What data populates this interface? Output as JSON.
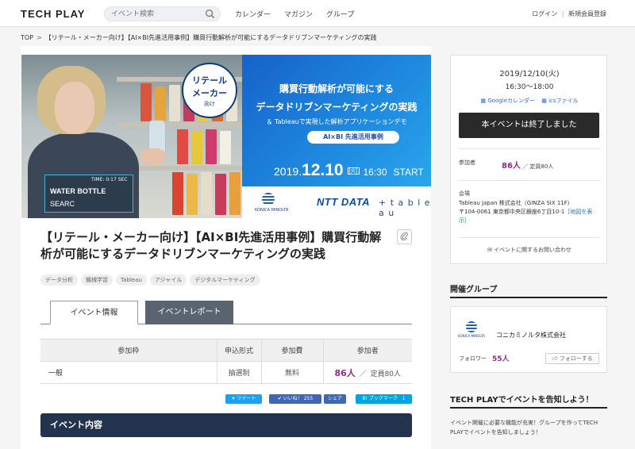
{
  "header": {
    "logo": "TECH PLAY",
    "search_placeholder": "イベント検索",
    "nav": [
      "カレンダー",
      "マガジン",
      "グループ"
    ],
    "login": "ログイン",
    "divider": "|",
    "register": "新規会員登録"
  },
  "breadcrumb": {
    "top": "TOP",
    "sep": ">",
    "current": "【リテール・メーカー向け】【AI×BI先進活用事例】購買行動解析が可能にするデータドリブンマーケティングの実践"
  },
  "hero": {
    "circle_line1": "リテール",
    "circle_line2": "メーカー",
    "circle_line3": "向け",
    "overlay_time": "TIME: 0:17 SEC",
    "overlay_label": "WATER BOTTLE",
    "overlay_search": "SEARC",
    "heading_line1": "購買行動解析が可能にする",
    "heading_line2": "データドリブンマーケティングの実践",
    "subheading": "＆ Tableauで実現した解析アプリケーションデモ",
    "pill": "AI×BI 先進活用事例",
    "date_year": "2019.",
    "date_md": "12.10",
    "date_dow": "[火]",
    "date_time": "16:30",
    "date_start": "START",
    "logo1_name": "KONICA MINOLTA",
    "logo2": "NTT DATA",
    "logo3": "+ t a b l e a u"
  },
  "event": {
    "title": "【リテール・メーカー向け】【AI×BI先進活用事例】購買行動解析が可能にするデータドリブンマーケティングの実践",
    "tags": [
      "データ分析",
      "機械学習",
      "Tableau",
      "アジャイル",
      "デジタルマーケティング"
    ]
  },
  "tabs": {
    "info": "イベント情報",
    "report": "イベントレポート"
  },
  "table": {
    "headers": [
      "参加枠",
      "申込形式",
      "参加費",
      "参加者"
    ],
    "rows": [
      {
        "name": "一般",
        "format": "抽選制",
        "fee": "無料",
        "count": "86人",
        "slash": "／",
        "capacity": "定員80人"
      }
    ]
  },
  "share": {
    "tweet": "ツイート",
    "like": "いいね！ 255",
    "share": "シェア",
    "bookmark": "B! ブックマーク",
    "bookmark_count": "1"
  },
  "section_title": "イベント内容",
  "sidebar": {
    "date": "2019/12/10(火)",
    "time": "16:30～18:00",
    "google_cal": "Googleカレンダー",
    "ics": "icsファイル",
    "ended_button": "本イベントは終了しました",
    "participants_label": "参加者",
    "participants_count": "86人",
    "participants_capacity": "／ 定員80人",
    "venue_label": "会場",
    "venue_name": "Tableau Japan 株式会社（GINZA SIX 11F）",
    "venue_address": "〒104-0061 東京都中央区銀座6丁目10-1",
    "map_link": "［地図を表示］",
    "inquiry": "イベントに関するお問い合わせ",
    "group_heading": "開催グループ",
    "group_name": "コニカミノルタ株式会社",
    "group_logo_name": "KONICA MINOLTA",
    "follower_label": "フォロワー",
    "follower_count": "55人",
    "follow_button": "フォローする",
    "promo_heading": "TECH PLAYでイベントを告知しよう！",
    "promo_text": "イベント開催に必要な機能が充実！グループを作ってTECH PLAYでイベントを告知しましょう！"
  },
  "colors": {
    "accent_purple": "#8e2b84",
    "navy": "#24334d",
    "hero_blue": "#1f8be0",
    "twitter": "#1da1f2",
    "facebook": "#4267b2",
    "hatena": "#00a4de"
  }
}
